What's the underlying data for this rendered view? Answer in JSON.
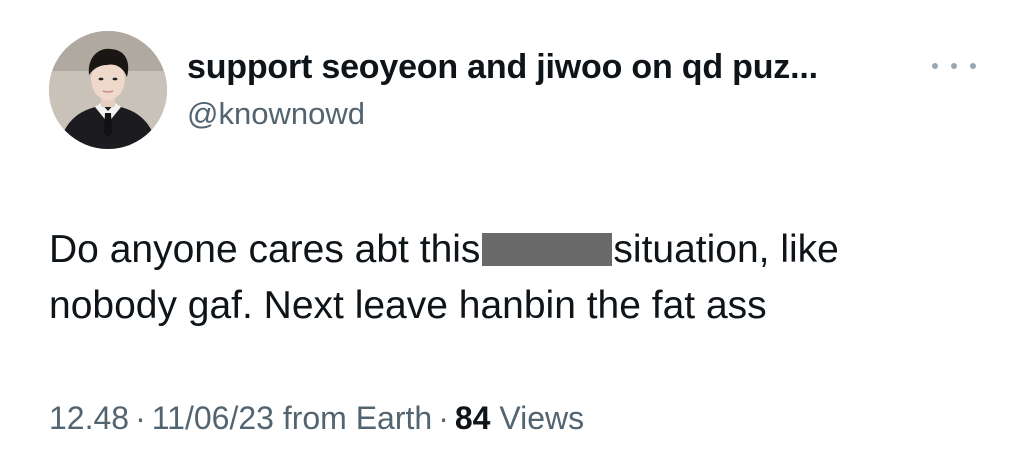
{
  "author": {
    "display_name": "support seoyeon and jiwoo on qd puz...",
    "handle": "@knownowd"
  },
  "tweet": {
    "text_line1_before": "Do anyone cares abt this",
    "text_line1_after": "situation, like",
    "text_line2": "nobody gaf. Next leave hanbin the fat ass"
  },
  "meta": {
    "time": "12.48",
    "separator": "·",
    "date_source": "11/06/23 from Earth",
    "views_count": "84",
    "views_label": "Views"
  },
  "icons": {
    "more": "more-horizontal-icon",
    "avatar": "avatar-image"
  },
  "colors": {
    "text_primary": "#0f1419",
    "text_secondary": "#536471",
    "redaction": "#6a6a6a"
  }
}
